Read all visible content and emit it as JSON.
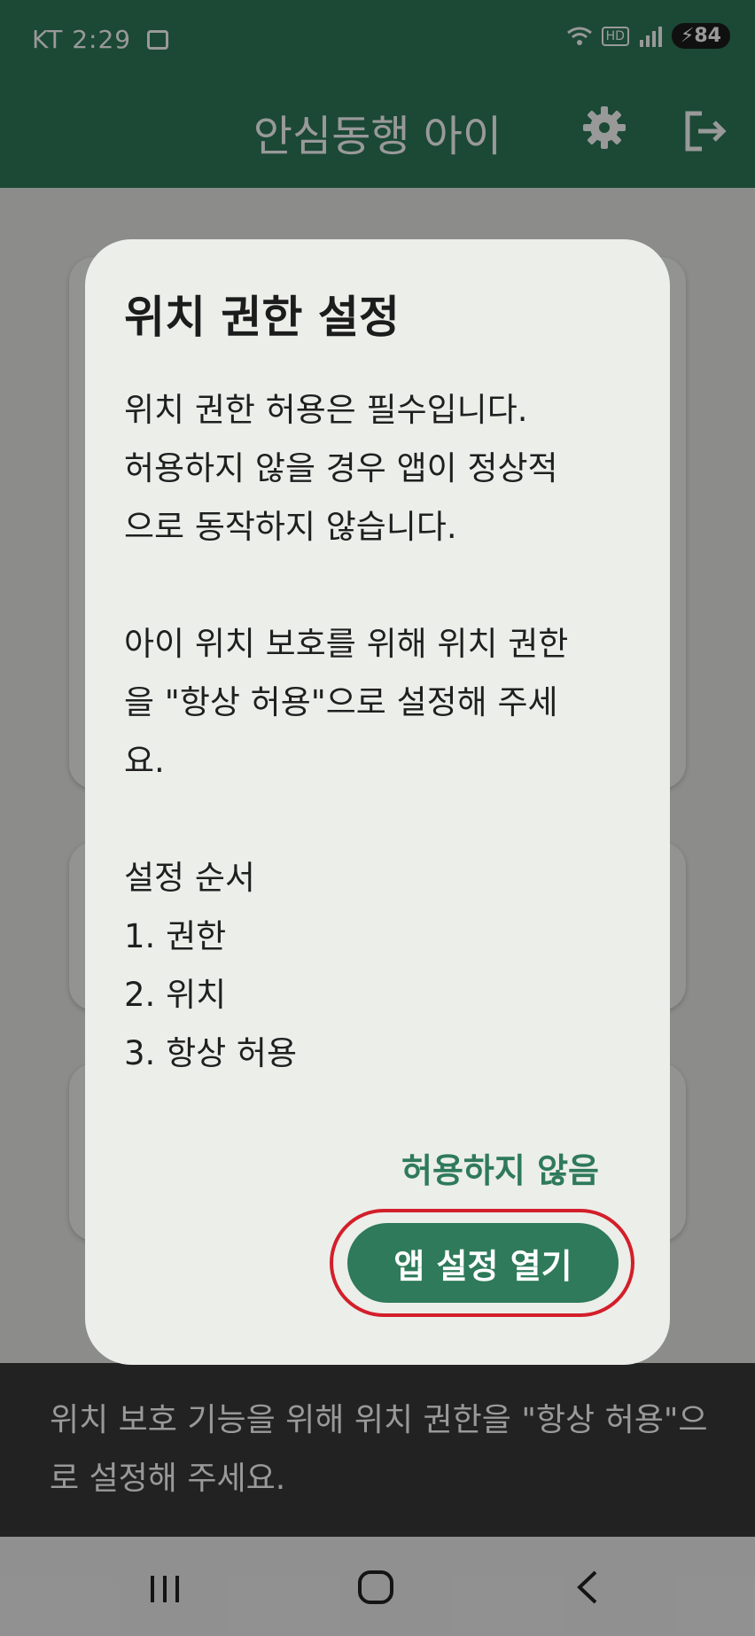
{
  "status_bar": {
    "carrier_time": "KT 2:29",
    "hd_label": "HD",
    "battery": "84"
  },
  "app_bar": {
    "title": "안심동행 아이",
    "icons": [
      "gear-icon",
      "logout-icon"
    ]
  },
  "dialog": {
    "title": "위치 권한 설정",
    "body_lines": [
      "위치 권한 허용은 필수입니다.",
      "허용하지 않을 경우 앱이 정상적",
      "으로 동작하지 않습니다.",
      "",
      "아이 위치 보호를 위해 위치 권한",
      "을 \"항상 허용\"으로 설정해 주세",
      "요.",
      "",
      "설정 순서",
      "1. 권한",
      "2. 위치",
      "3. 항상 허용"
    ],
    "deny_label": "허용하지 않음",
    "open_settings_label": "앱 설정 열기"
  },
  "snackbar": {
    "text": "위치 보호 기능을 위해 위치 권한을 \"항상 허용\"으로 설정해 주세요."
  },
  "nav_bar": {
    "icons": [
      "recents-icon",
      "home-icon",
      "back-icon"
    ]
  },
  "colors": {
    "primary": "#2e7a5a",
    "highlight": "#d31f2a"
  }
}
